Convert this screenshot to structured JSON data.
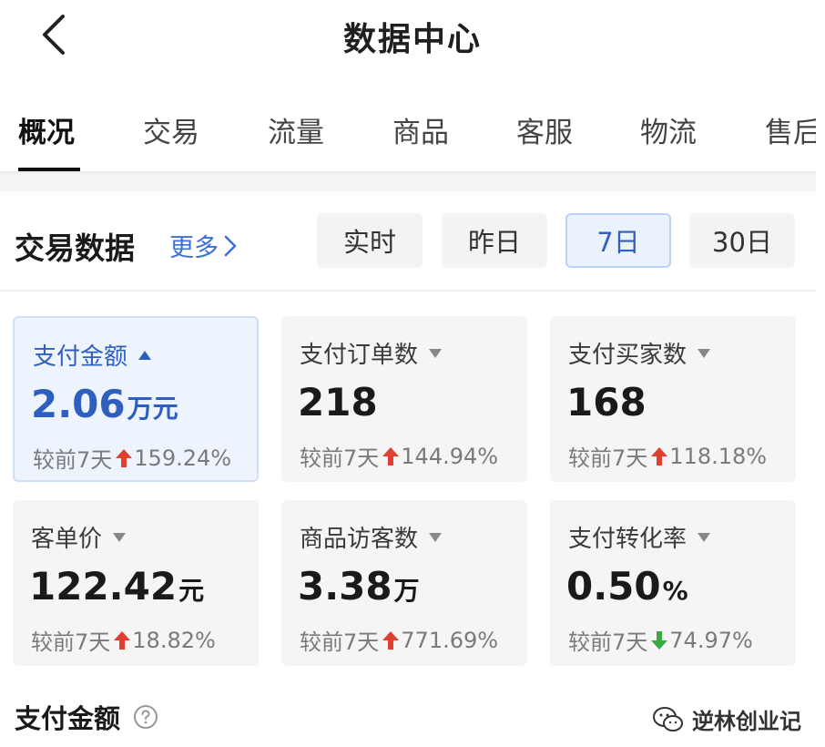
{
  "header": {
    "title": "数据中心",
    "back_icon": "chevron-left-icon"
  },
  "tabs": [
    {
      "label": "概况",
      "active": true
    },
    {
      "label": "交易"
    },
    {
      "label": "流量"
    },
    {
      "label": "商品"
    },
    {
      "label": "客服"
    },
    {
      "label": "物流"
    },
    {
      "label": "售后"
    }
  ],
  "section": {
    "title": "交易数据",
    "more_label": "更多",
    "ranges": [
      {
        "label": "实时"
      },
      {
        "label": "昨日"
      },
      {
        "label": "7日",
        "selected": true
      },
      {
        "label": "30日"
      }
    ]
  },
  "cards": [
    {
      "label": "支付金额",
      "value": "2.06",
      "unit": "万元",
      "compare_label": "较前7天",
      "trend": "up",
      "change": "159.24%",
      "selected": true
    },
    {
      "label": "支付订单数",
      "value": "218",
      "unit": "",
      "compare_label": "较前7天",
      "trend": "up",
      "change": "144.94%"
    },
    {
      "label": "支付买家数",
      "value": "168",
      "unit": "",
      "compare_label": "较前7天",
      "trend": "up",
      "change": "118.18%"
    },
    {
      "label": "客单价",
      "value": "122.42",
      "unit": "元",
      "compare_label": "较前7天",
      "trend": "up",
      "change": "18.82%"
    },
    {
      "label": "商品访客数",
      "value": "3.38",
      "unit": "万",
      "compare_label": "较前7天",
      "trend": "up",
      "change": "771.69%"
    },
    {
      "label": "支付转化率",
      "value": "0.50",
      "unit": "%",
      "compare_label": "较前7天",
      "trend": "down",
      "change": "74.97%"
    }
  ],
  "bottom": {
    "title": "支付金额"
  },
  "watermark": {
    "text": "逆林创业记"
  },
  "colors": {
    "accent": "#2e5fbf",
    "up": "#e0402f",
    "down": "#3aa843"
  }
}
